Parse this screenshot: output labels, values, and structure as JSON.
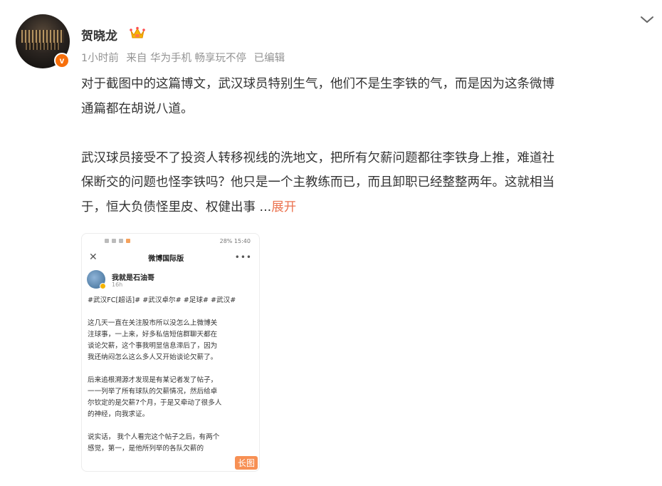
{
  "author": {
    "name": "贺晓龙",
    "avatar_icon": "avatar-photo",
    "verified_badge_text": "v",
    "crown_icon": "crown-icon"
  },
  "meta": {
    "time": "1小时前",
    "source": "来自 华为手机 畅享玩不停",
    "edited": "已编辑"
  },
  "post": {
    "paragraph1_line1": "对于截图中的这篇博文，武汉球员特别生气，他们不是生李铁的气，而是因为这条微博",
    "paragraph1_line2": "通篇都在胡说八道。",
    "paragraph2_line1": "武汉球员接受不了投资人转移视线的洗地文，把所有欠薪问题都往李铁身上推，难道社",
    "paragraph2_line2": "保断交的问题也怪李铁吗？他只是一个主教练而已，而且卸职已经整整两年。这就相当",
    "paragraph2_line3": "于，恒大负债怪里皮、权健出事 ...",
    "expand_label": "展开"
  },
  "screenshot": {
    "status_right": "28% 15:40",
    "title": "微博国际版",
    "close": "✕",
    "more": "•••",
    "inner_user": "我就是石油哥",
    "inner_time": "16h",
    "tags": "#武汉FC[超话]# #武汉卓尔# #足球# #武汉#",
    "p1_l1": "这几天一直在关注股市所以没怎么上微博关",
    "p1_l2": "注球事，一上来，好多私信短信群聊天都在",
    "p1_l3": "谈论欠薪，这个事我明显信息滞后了，因为",
    "p1_l4": "我还纳闷怎么这么多人又开始谈论欠薪了。",
    "p2_l1": "后来追根溯源才发现是有某记者发了帖子，",
    "p2_l2": "一一列举了所有球队的欠薪情况，然后给卓",
    "p2_l3": "尔钦定的是欠薪7个月，于是又牵动了很多人",
    "p2_l4": "的神经，向我求证。",
    "p3_l1": "说实话， 我个人看完这个帖子之后，有两个",
    "p3_l2": "感觉，第一，是他所列举的各队欠薪的",
    "long_image_label": "长图"
  },
  "colors": {
    "accent": "#eb7350",
    "meta_gray": "#939393",
    "badge_orange": "#f76f0b"
  }
}
